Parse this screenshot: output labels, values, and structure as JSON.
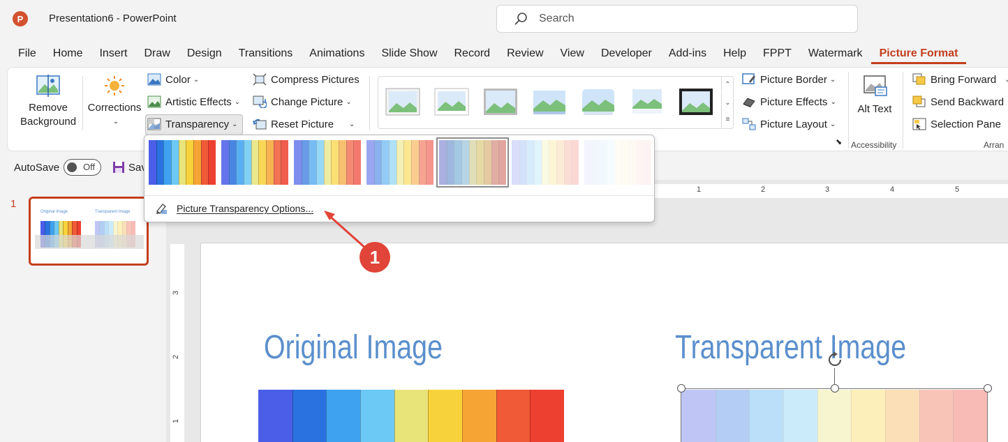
{
  "window": {
    "app_letter": "P",
    "title": "Presentation6  -  PowerPoint"
  },
  "search": {
    "placeholder": "Search"
  },
  "tabs": [
    "File",
    "Home",
    "Insert",
    "Draw",
    "Design",
    "Transitions",
    "Animations",
    "Slide Show",
    "Record",
    "Review",
    "View",
    "Developer",
    "Add-ins",
    "Help",
    "FPPT",
    "Watermark",
    "Picture Format"
  ],
  "active_tab": "Picture Format",
  "ribbon": {
    "remove_background": "Remove Background",
    "corrections": "Corrections",
    "color": "Color",
    "artistic_effects": "Artistic Effects",
    "transparency": "Transparency",
    "compress_pictures": "Compress Pictures",
    "change_picture": "Change Picture",
    "reset_picture": "Reset Picture",
    "picture_border": "Picture Border",
    "picture_effects": "Picture Effects",
    "picture_layout": "Picture Layout",
    "alt_text": "Alt Text",
    "accessibility_label": "Accessibility",
    "bring_forward": "Bring Forward",
    "send_backward": "Send Backward",
    "selection_pane": "Selection Pane",
    "arrange_label": "Arran"
  },
  "qat": {
    "autosave_label": "AutoSave",
    "toggle_state": "Off",
    "save_label": "Sav"
  },
  "transparency_menu": {
    "presets_count": 7,
    "selected_index": 4,
    "option_label": "Picture Transparency Options..."
  },
  "slide_panel": {
    "slide_number": "1",
    "thumb_title_left": "Original Image",
    "thumb_title_right": "Transparent Image"
  },
  "ruler": {
    "h": [
      "1",
      "2",
      "3",
      "4",
      "5"
    ],
    "v": [
      "3",
      "2",
      "1"
    ]
  },
  "slide": {
    "title_left": "Original Image",
    "title_right": "Transparent Image"
  },
  "callout": {
    "number": "1"
  },
  "colors": {
    "accent": "#c43e1c",
    "title_blue": "#5b8fcc",
    "callout_red": "#e14438",
    "stripes": [
      "#4a5ee8",
      "#2a72e0",
      "#3ea2f0",
      "#6cc8f4",
      "#e8e47a",
      "#f8d23a",
      "#f6a534",
      "#f05a36",
      "#ee4030"
    ]
  }
}
